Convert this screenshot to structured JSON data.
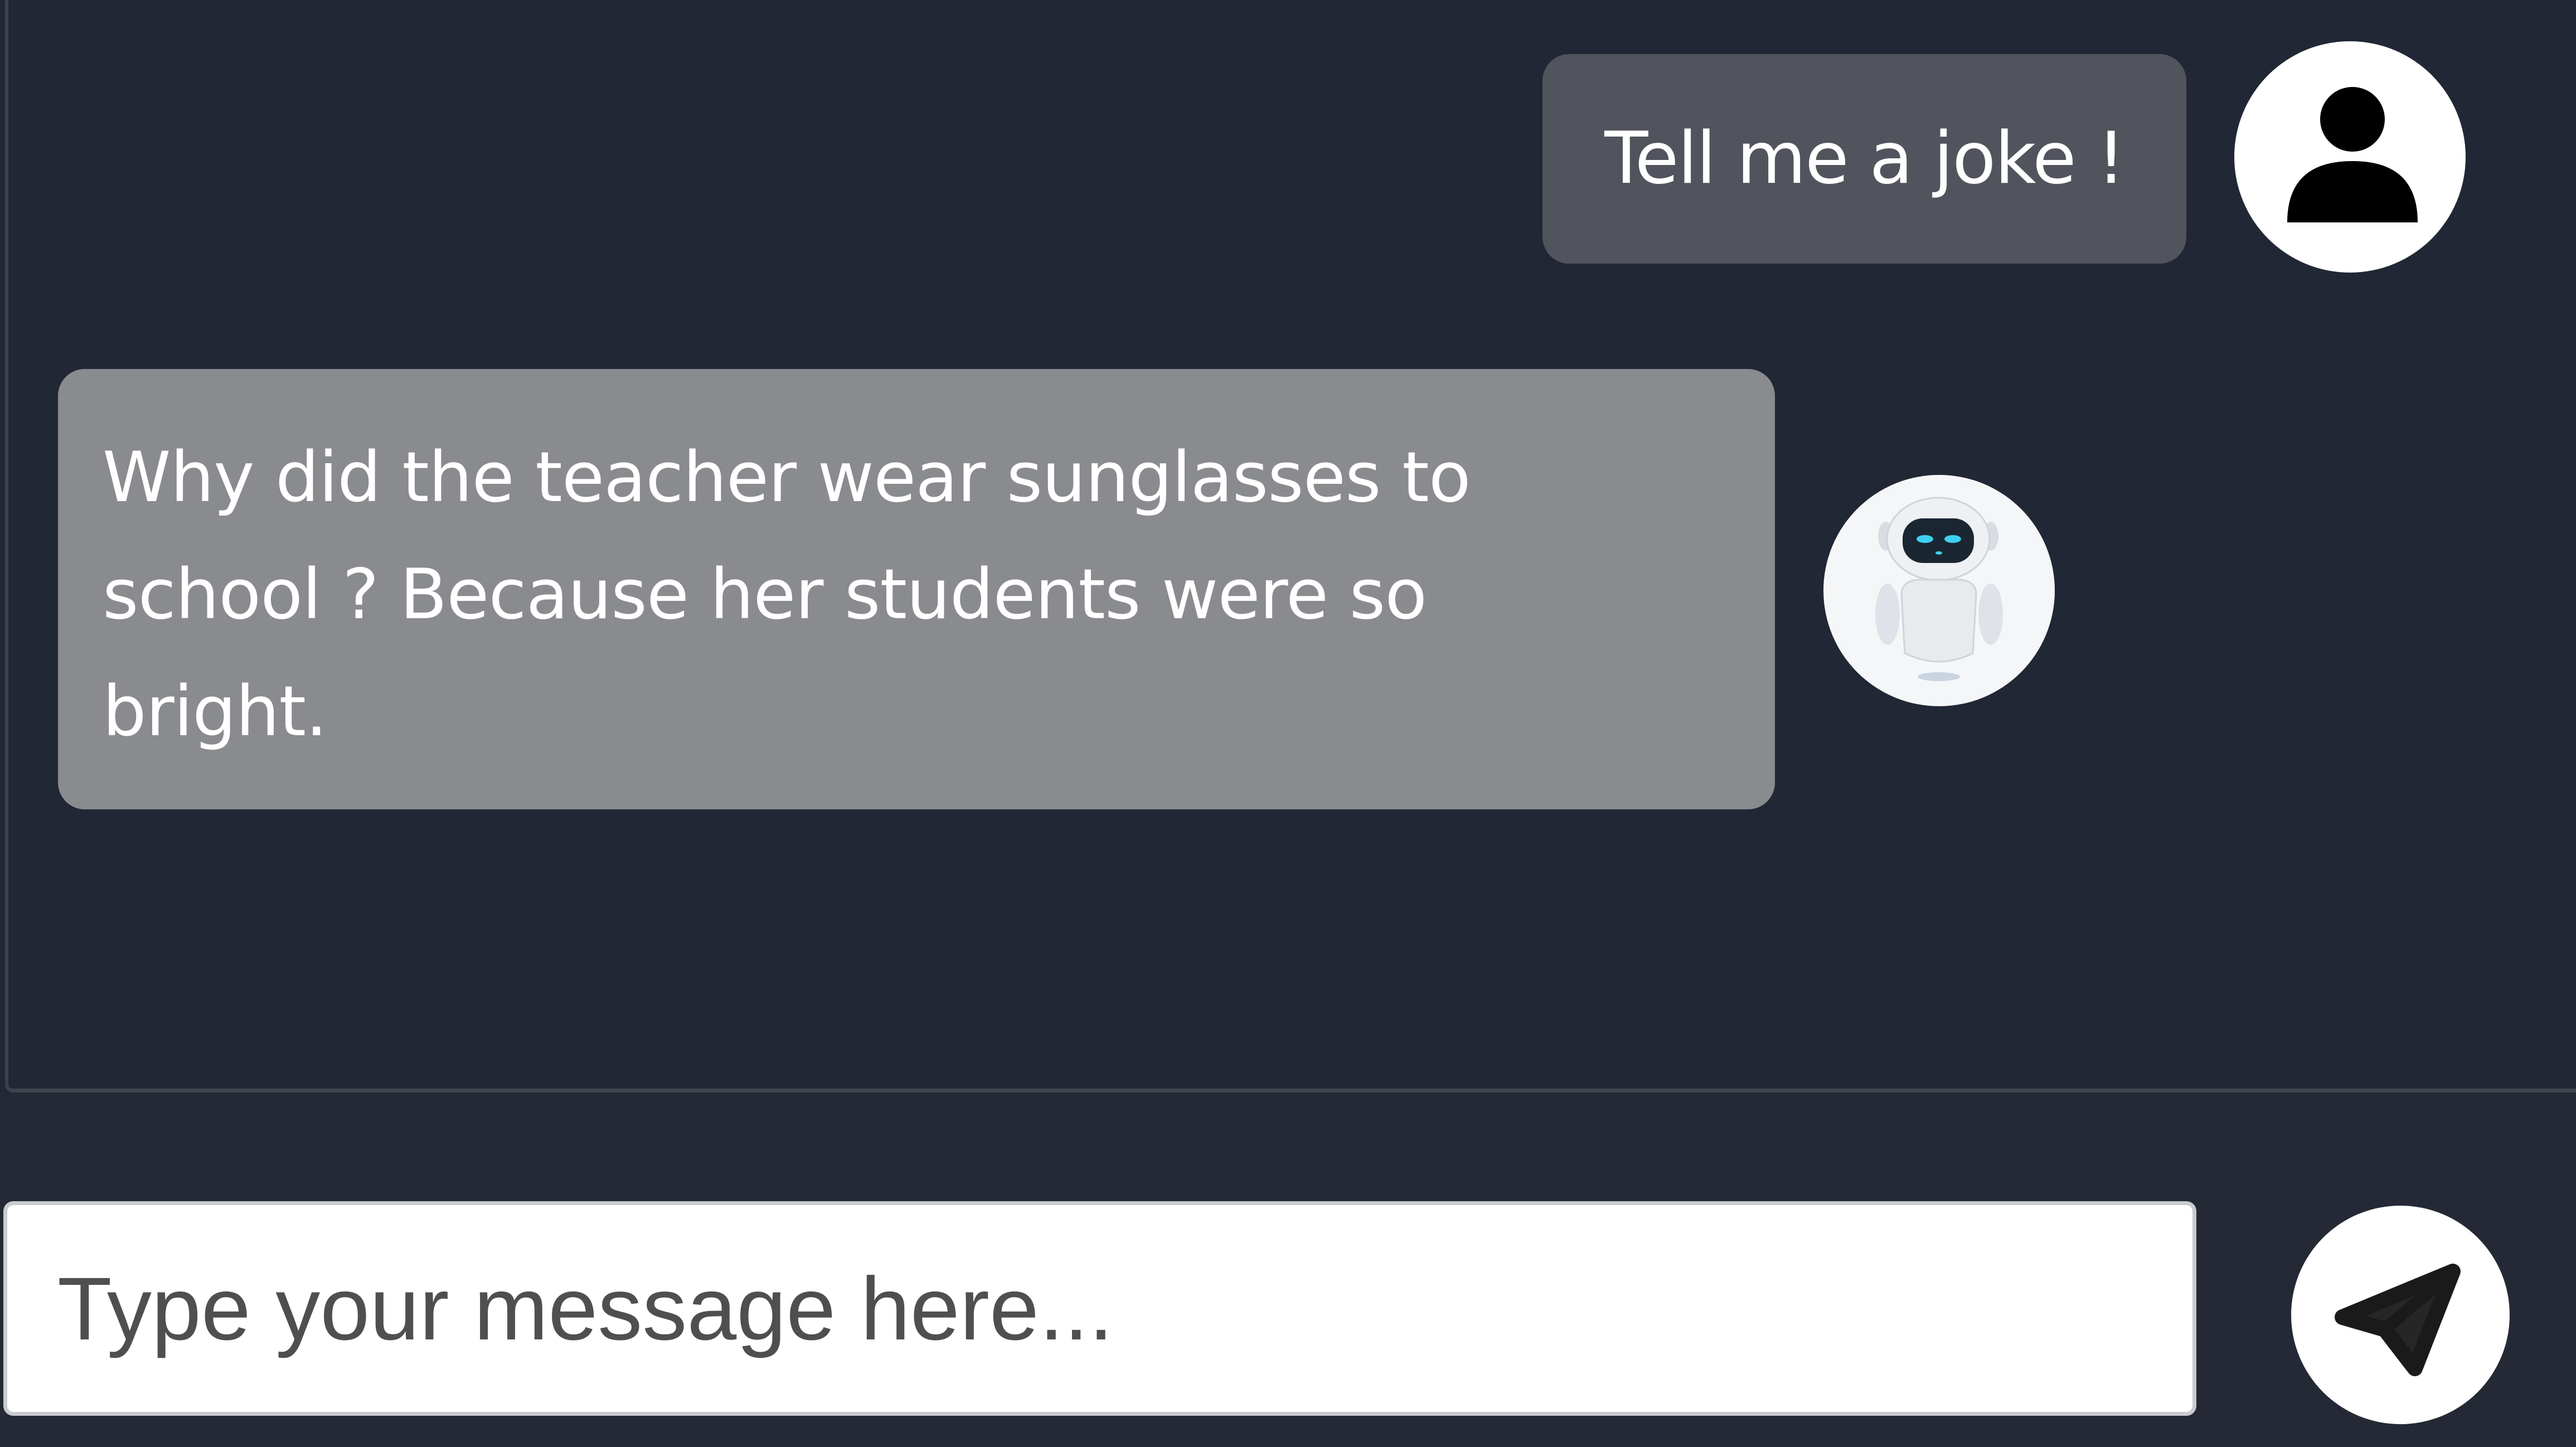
{
  "chat": {
    "messages": [
      {
        "sender": "user",
        "avatar_icon": "user-silhouette-icon",
        "text": "Tell me a joke !"
      },
      {
        "sender": "bot",
        "avatar_icon": "robot-icon",
        "lines": [
          "Why did the teacher wear sunglasses to",
          "school ? Because her students were so",
          "bright."
        ]
      }
    ]
  },
  "composer": {
    "input_value": "",
    "placeholder": "Type your message here...",
    "send_icon": "paper-plane-icon"
  },
  "colors": {
    "background": "#232733",
    "user_bubble": "#51545c",
    "bot_bubble": "#8a8b8f",
    "text": "#ffffff",
    "robot_eyes": "#3fd0f0"
  }
}
